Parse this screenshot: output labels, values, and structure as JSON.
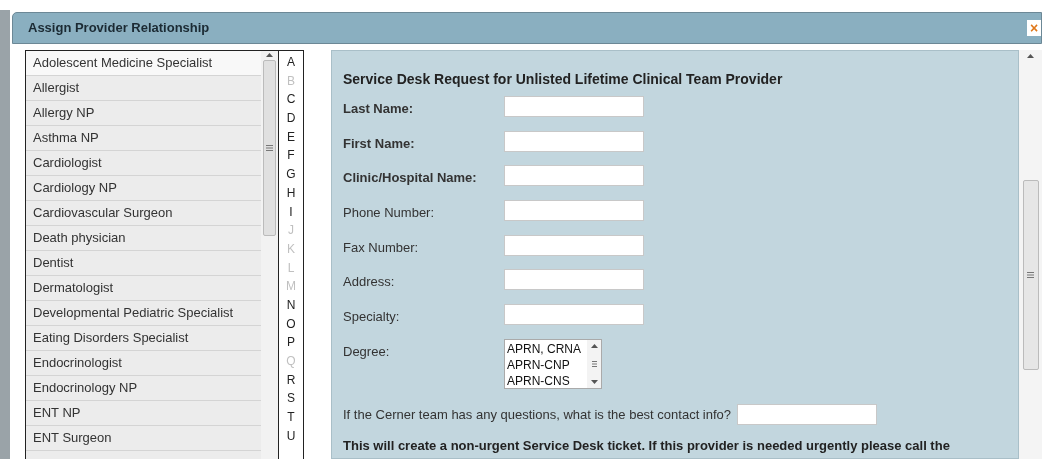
{
  "window": {
    "title": "Assign Provider Relationship",
    "close": "×"
  },
  "provider_list": [
    {
      "label": "Adolescent Medicine Specialist",
      "selected": true
    },
    {
      "label": "Allergist",
      "selected": false
    },
    {
      "label": "Allergy NP",
      "selected": false
    },
    {
      "label": "Asthma NP",
      "selected": false
    },
    {
      "label": "Cardiologist",
      "selected": false
    },
    {
      "label": "Cardiology NP",
      "selected": false
    },
    {
      "label": "Cardiovascular Surgeon",
      "selected": false
    },
    {
      "label": "Death physician",
      "selected": false
    },
    {
      "label": "Dentist",
      "selected": false
    },
    {
      "label": "Dermatologist",
      "selected": false
    },
    {
      "label": "Developmental Pediatric Specialist",
      "selected": false
    },
    {
      "label": "Eating Disorders Specialist",
      "selected": false
    },
    {
      "label": "Endocrinologist",
      "selected": false
    },
    {
      "label": "Endocrinology NP",
      "selected": false
    },
    {
      "label": "ENT NP",
      "selected": false
    },
    {
      "label": "ENT Surgeon",
      "selected": false
    }
  ],
  "alphabet": [
    {
      "letter": "A",
      "disabled": false
    },
    {
      "letter": "B",
      "disabled": true
    },
    {
      "letter": "C",
      "disabled": false
    },
    {
      "letter": "D",
      "disabled": false
    },
    {
      "letter": "E",
      "disabled": false
    },
    {
      "letter": "F",
      "disabled": false
    },
    {
      "letter": "G",
      "disabled": false
    },
    {
      "letter": "H",
      "disabled": false
    },
    {
      "letter": "I",
      "disabled": false
    },
    {
      "letter": "J",
      "disabled": true
    },
    {
      "letter": "K",
      "disabled": true
    },
    {
      "letter": "L",
      "disabled": true
    },
    {
      "letter": "M",
      "disabled": true
    },
    {
      "letter": "N",
      "disabled": false
    },
    {
      "letter": "O",
      "disabled": false
    },
    {
      "letter": "P",
      "disabled": false
    },
    {
      "letter": "Q",
      "disabled": true
    },
    {
      "letter": "R",
      "disabled": false
    },
    {
      "letter": "S",
      "disabled": false
    },
    {
      "letter": "T",
      "disabled": false
    },
    {
      "letter": "U",
      "disabled": false
    }
  ],
  "form": {
    "heading": "Service Desk Request for Unlisted Lifetime Clinical Team Provider",
    "fields": [
      {
        "label": "Last Name:",
        "kind": "text",
        "required": true
      },
      {
        "label": "First Name:",
        "kind": "text",
        "required": true
      },
      {
        "label": "Clinic/Hospital Name:",
        "kind": "text",
        "required": true
      },
      {
        "label": "Phone Number:",
        "kind": "text",
        "required": false
      },
      {
        "label": "Fax Number:",
        "kind": "text",
        "required": false
      },
      {
        "label": "Address:",
        "kind": "text",
        "required": false
      },
      {
        "label": "Specialty:",
        "kind": "text",
        "required": false
      },
      {
        "label": "Degree:",
        "kind": "listbox",
        "required": false,
        "options": [
          "APRN, CRNA",
          "APRN-CNP",
          "APRN-CNS"
        ]
      }
    ],
    "contact_question": "If the Cerner team has any questions, what is the best contact info?",
    "notice": "This will create a non-urgent Service Desk ticket. If this provider is needed urgently please call the"
  }
}
